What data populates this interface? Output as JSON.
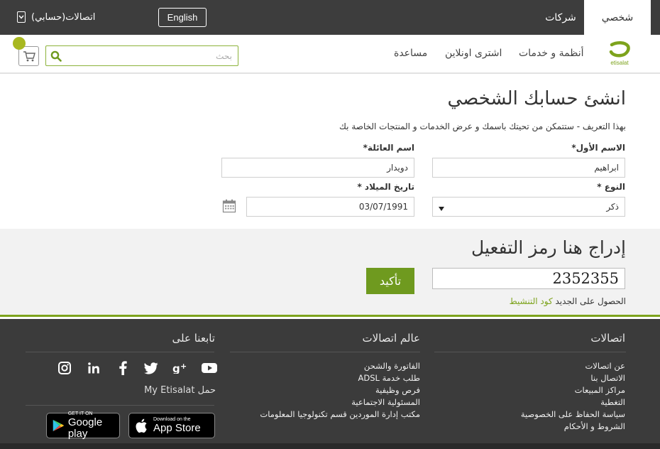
{
  "topbar": {
    "personal_tab": "شخصي",
    "business_tab": "شركات",
    "language_button": "English",
    "account_link": "اتصالات(حسابي)"
  },
  "header": {
    "logo_text": "etisalat",
    "nav": [
      "أنظمة و خدمات",
      "اشترى اونلاين",
      "مساعدة"
    ],
    "search_placeholder": "بحث"
  },
  "form": {
    "title": "انشئ حسابك الشخصي",
    "description": "بهذا التعريف - ستتمكن من تحيتك باسمك و عرض الخدمات و المنتجات الخاصة بك",
    "first_name_label": "الاسم الأول*",
    "first_name_value": "ابراهيم",
    "last_name_label": "اسم العائلة*",
    "last_name_value": "دويدار",
    "gender_label": "النوع *",
    "gender_value": "ذكر",
    "dob_label": "تاريخ الميلاد *",
    "dob_value": "03/07/1991"
  },
  "activation": {
    "title": "إدراج هنا رمز التفعيل",
    "code_value": "2352355",
    "confirm_button": "تأكيد",
    "help_text": "الحصول على الجديد",
    "help_link": "كود التنشيط"
  },
  "footer": {
    "etisalat_heading": "اتصالات",
    "etisalat_links": [
      "عن اتصالات",
      "الاتصال بنا",
      "مراكز المبيعات",
      "التغطية",
      "سياسة الحفاظ على الخصوصية",
      "الشروط و الأحكام"
    ],
    "world_heading": "عالم اتصالات",
    "world_links": [
      "الفاتورة والشحن",
      "طلب خدمة ADSL",
      "فرص وظيفية",
      "المسئولية الاجتماعية",
      "مكتب إدارة الموردين قسم تكنولوجيا المعلومات"
    ],
    "follow_heading": "تابعنا على",
    "carry_text": "حمل My Etisalat",
    "google_play_small": "GET IT ON",
    "google_play_big": "Google play",
    "app_store_small": "Download on the",
    "app_store_big": "App Store"
  },
  "colors": {
    "brand_green": "#7da31c",
    "button_green": "#6f9a1f",
    "dark_bar": "#3d3d3d"
  }
}
